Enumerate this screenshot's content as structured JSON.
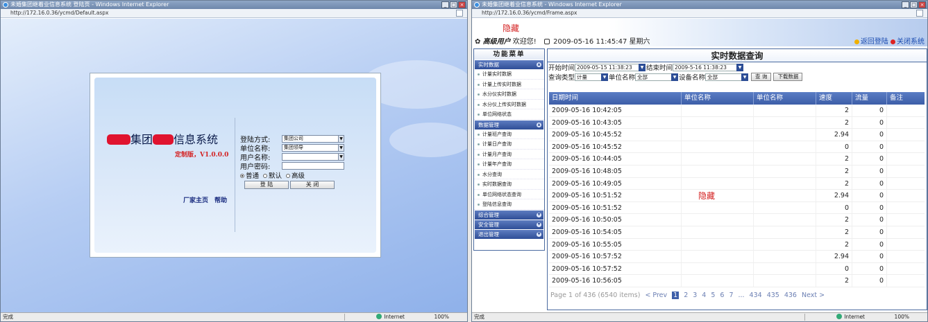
{
  "left": {
    "window_title": "未婚集团继着业信息系统 登陆页 - Windows Internet Explorer",
    "address": "http://172.16.0.36/ycmd/Default.aspx",
    "system_title_visible": "集团",
    "system_title_suffix": "信息系统",
    "version": "定制版，V1.0.0.0",
    "form": {
      "login_mode_label": "登陆方式:",
      "login_mode_value": "集团公司",
      "unit_label": "单位名称:",
      "unit_value": "集团领导",
      "user_label": "用户名称:",
      "user_value": "",
      "password_label": "用户密码:",
      "radios": [
        "普通",
        "默认",
        "高级"
      ],
      "login_button": "登 陆",
      "close_button": "关 闭"
    },
    "links": [
      "厂家主页",
      "帮助"
    ],
    "status": {
      "left": "完成",
      "zone": "Internet",
      "zoom": "100%"
    }
  },
  "right": {
    "window_title": "未婚集团继着业信息系统 - Windows Internet Explorer",
    "address": "http://172.16.0.36/ycmd/Frame.aspx",
    "hidden_top": "隐藏",
    "user_role": "高级用户",
    "welcome": "欢迎您!",
    "datetime": "2009-05-16 11:45:47 星期六",
    "return_login": "返回登陆",
    "close_system": "关闭系统",
    "sidebar": {
      "title": "功能菜单",
      "sections": [
        {
          "title": "实时数据",
          "items": [
            "计量实时数据",
            "计量上传实时数据",
            "水分仪实时数据",
            "水分仪上传实时数据",
            "单位网络状态"
          ]
        },
        {
          "title": "数据管理",
          "items": [
            "计量班产查询",
            "计量日产查询",
            "计量月产查询",
            "计量年产查询",
            "水分查询",
            "实时数据查询",
            "单位网络状态查询",
            "登陆信息查询"
          ]
        },
        {
          "title": "综合管理",
          "items": []
        },
        {
          "title": "安全管理",
          "items": []
        },
        {
          "title": "退出管理",
          "items": []
        }
      ]
    },
    "query": {
      "title": "实时数据查询",
      "start_label": "开始时间",
      "start_value": "2009-05-15 11:38:23",
      "end_label": "结束时间",
      "end_value": "2009-5-16 11:38:23",
      "type_label": "查询类型",
      "type_value": "计量",
      "unit_label": "单位名称",
      "unit_value": "全部",
      "device_label": "设备名称",
      "device_value": "全部",
      "query_button": "查 询",
      "download_button": "下载数据"
    },
    "grid": {
      "headers": [
        "日期时间",
        "单位名称",
        "单位名称",
        "速度",
        "流量",
        "备注"
      ],
      "rows": [
        [
          "2009-05-16 10:42:05",
          "2",
          "0"
        ],
        [
          "2009-05-16 10:43:05",
          "2",
          "0"
        ],
        [
          "2009-05-16 10:45:52",
          "2.94",
          "0"
        ],
        [
          "2009-05-16 10:45:52",
          "0",
          "0"
        ],
        [
          "2009-05-16 10:44:05",
          "2",
          "0"
        ],
        [
          "2009-05-16 10:48:05",
          "2",
          "0"
        ],
        [
          "2009-05-16 10:49:05",
          "2",
          "0"
        ],
        [
          "2009-05-16 10:51:52",
          "2.94",
          "0"
        ],
        [
          "2009-05-16 10:51:52",
          "0",
          "0"
        ],
        [
          "2009-05-16 10:50:05",
          "2",
          "0"
        ],
        [
          "2009-05-16 10:54:05",
          "2",
          "0"
        ],
        [
          "2009-05-16 10:55:05",
          "2",
          "0"
        ],
        [
          "2009-05-16 10:57:52",
          "2.94",
          "0"
        ],
        [
          "2009-05-16 10:57:52",
          "0",
          "0"
        ],
        [
          "2009-05-16 10:56:05",
          "2",
          "0"
        ]
      ],
      "hidden_mid": "隐藏"
    },
    "pager": {
      "info": "Page 1 of 436 (6540 items)",
      "prev": "< Prev",
      "pages": [
        "1",
        "2",
        "3",
        "4",
        "5",
        "6",
        "7",
        "...",
        "434",
        "435",
        "436"
      ],
      "next": "Next >"
    },
    "status": {
      "left": "完成",
      "zone": "Internet",
      "zoom": "100%"
    }
  }
}
